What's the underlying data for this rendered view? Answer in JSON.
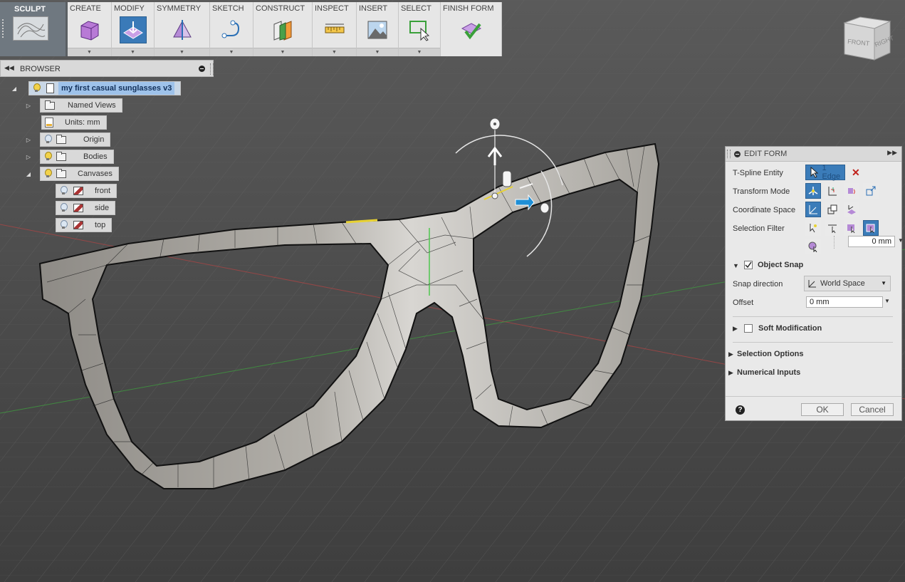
{
  "toolbar": {
    "mode": "SCULPT",
    "groups": [
      {
        "label": "CREATE",
        "icon": "box-icon"
      },
      {
        "label": "MODIFY",
        "icon": "modify-form-icon"
      },
      {
        "label": "SYMMETRY",
        "icon": "symmetry-icon"
      },
      {
        "label": "SKETCH",
        "icon": "sketch-curve-icon"
      },
      {
        "label": "CONSTRUCT",
        "icon": "construct-plane-icon"
      },
      {
        "label": "INSPECT",
        "icon": "measure-icon"
      },
      {
        "label": "INSERT",
        "icon": "insert-image-icon"
      },
      {
        "label": "SELECT",
        "icon": "select-box-icon"
      },
      {
        "label": "FINISH FORM",
        "icon": "finish-form-icon"
      }
    ]
  },
  "browser": {
    "title": "BROWSER",
    "root": "my first casual sunglasses v3",
    "items": [
      {
        "label": "Named Views"
      },
      {
        "label": "Units: mm"
      },
      {
        "label": "Origin"
      },
      {
        "label": "Bodies"
      },
      {
        "label": "Canvases"
      },
      {
        "label": "front"
      },
      {
        "label": "side"
      },
      {
        "label": "top"
      }
    ]
  },
  "viewcube": {
    "front": "FRONT",
    "right": "RIGHT"
  },
  "edit_form": {
    "title": "EDIT FORM",
    "tspline_label": "T-Spline Entity",
    "tspline_value": "1 Edge",
    "transform_label": "Transform Mode",
    "coord_label": "Coordinate Space",
    "filter_label": "Selection Filter",
    "filter_value": "0 mm",
    "object_snap": "Object Snap",
    "snap_direction_label": "Snap direction",
    "snap_direction_value": "World Space",
    "offset_label": "Offset",
    "offset_value": "0 mm",
    "soft_modification": "Soft Modification",
    "selection_options": "Selection Options",
    "numerical_inputs": "Numerical Inputs",
    "ok": "OK",
    "cancel": "Cancel"
  },
  "colors": {
    "viewport_bg": "#4a4a4a",
    "accent": "#3b7cb9",
    "root_highlight": "#9ec2ea"
  }
}
